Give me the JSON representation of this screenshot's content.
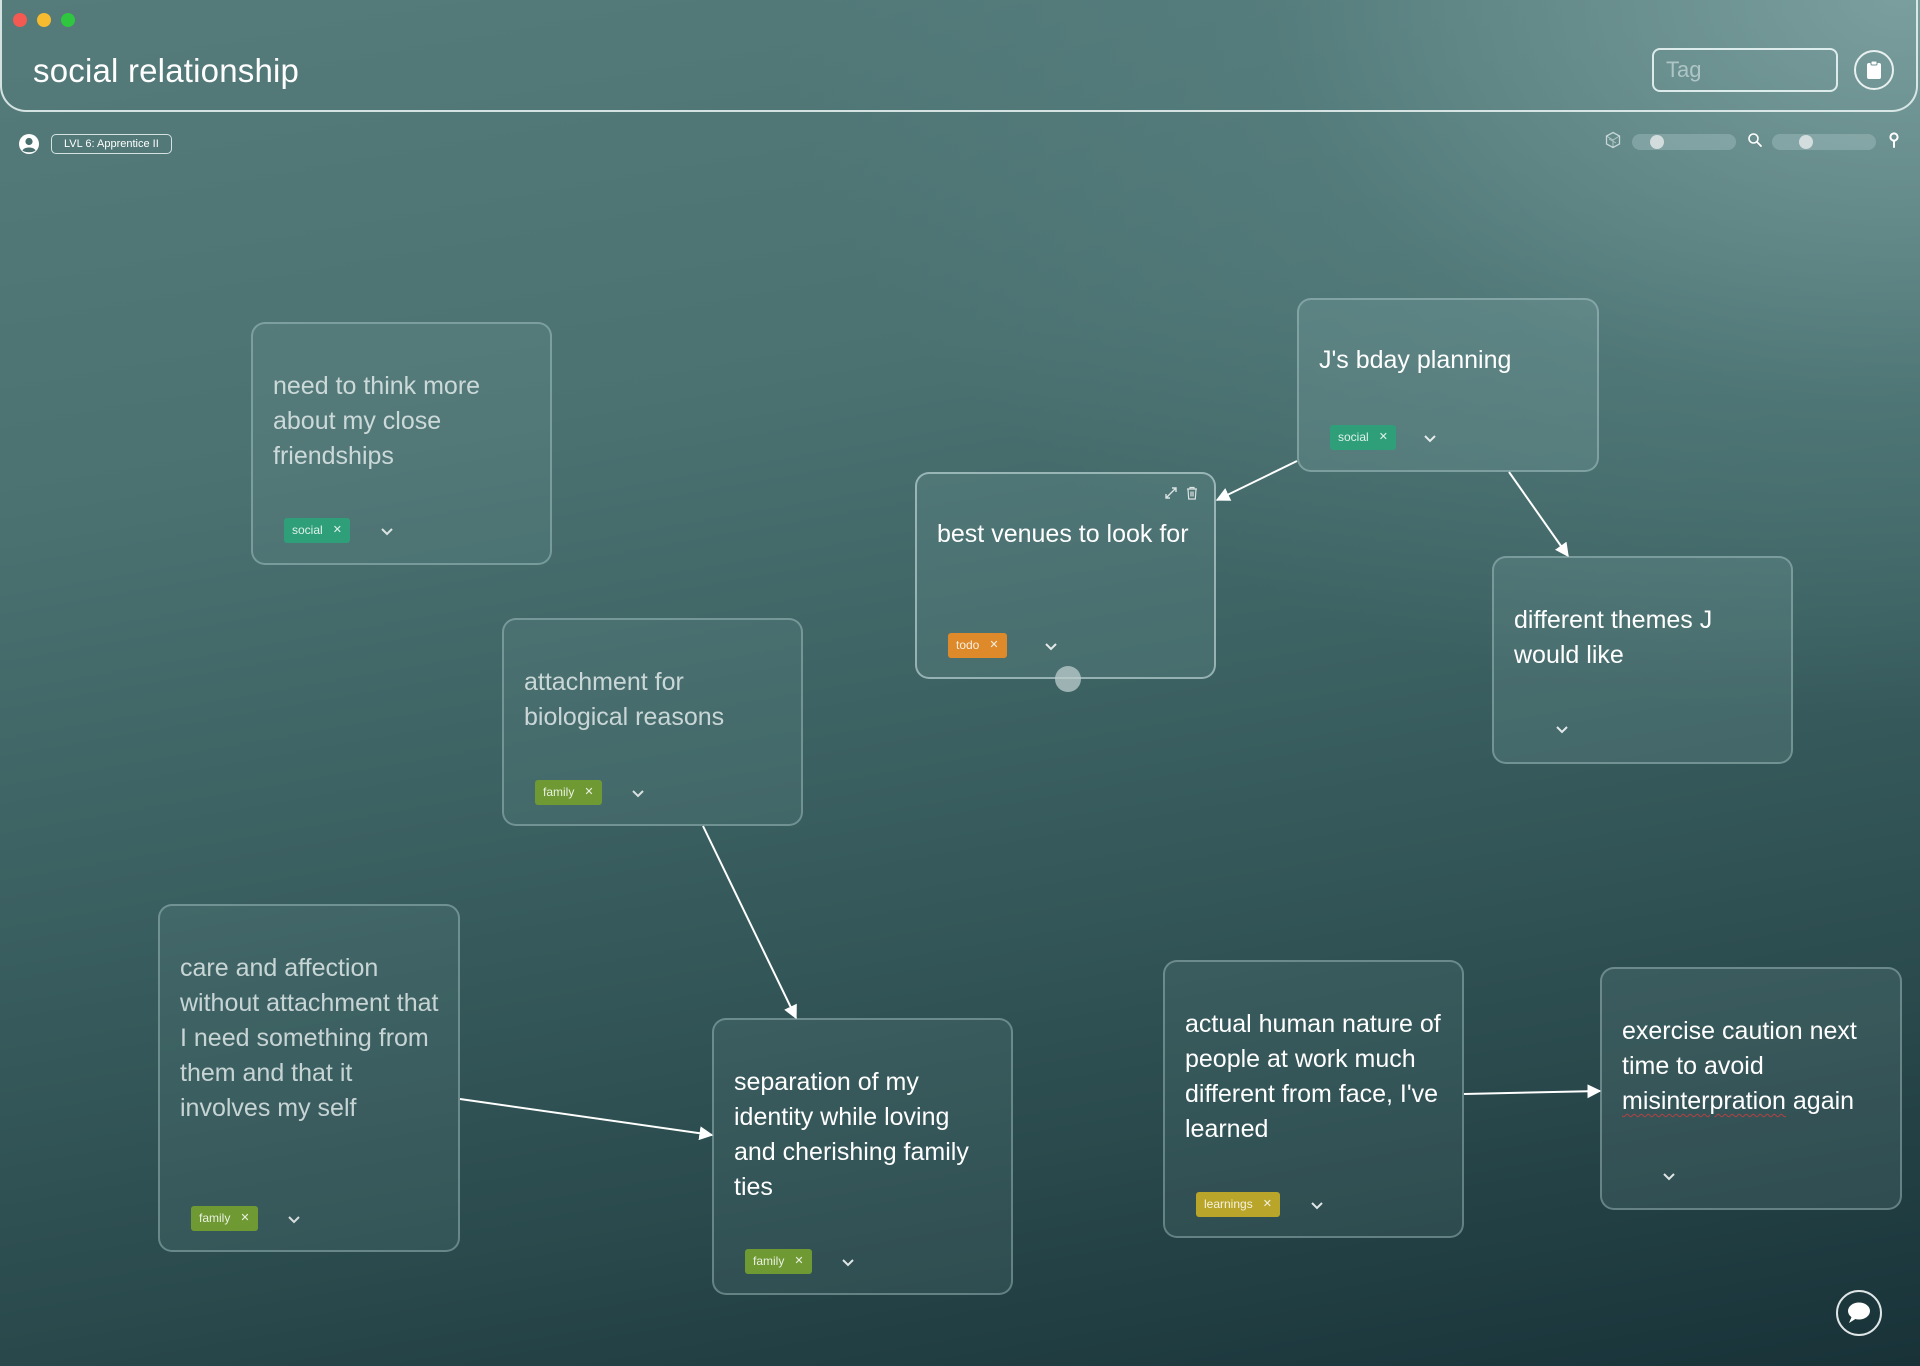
{
  "window": {
    "controls": [
      "close",
      "minimize",
      "maximize"
    ]
  },
  "header": {
    "title": "social relationship",
    "tag_input": {
      "value": "",
      "placeholder": "Tag"
    },
    "clipboard_icon": "clipboard-icon"
  },
  "subbar": {
    "user_icon": "user-circle-icon",
    "level_badge": "LVL 6: Apprentice II",
    "tools": [
      {
        "icon": "network-icon",
        "slider_value": 0.2
      },
      {
        "icon": "search-icon",
        "slider_value": 0.3
      },
      {
        "icon": "pin-icon"
      }
    ]
  },
  "tag_colors": {
    "social": "#2f9f7a",
    "family": "#6f9a33",
    "todo": "#df8a2a",
    "learnings": "#b9a52a"
  },
  "cards": [
    {
      "id": "c1",
      "text": "need to think more about my close friendships",
      "tags": [
        "social"
      ],
      "dim": true
    },
    {
      "id": "c2",
      "text": "J's bday planning",
      "tags": [
        "social"
      ],
      "dim": false
    },
    {
      "id": "c3",
      "text": "best venues to look for",
      "tags": [
        "todo"
      ],
      "dim": false,
      "selected": true,
      "actions": [
        "expand-icon",
        "trash-icon"
      ]
    },
    {
      "id": "c4",
      "text": "different themes J would like",
      "tags": [],
      "dim": false
    },
    {
      "id": "c5",
      "text": "attachment for biological reasons",
      "tags": [
        "family"
      ],
      "dim": true
    },
    {
      "id": "c6",
      "text": "care and affection without attachment that I need something from them and that it involves my self",
      "tags": [
        "family"
      ],
      "dim": true
    },
    {
      "id": "c7",
      "text": "separation of my identity while loving and cherishing family ties",
      "tags": [
        "family"
      ],
      "dim": false
    },
    {
      "id": "c8",
      "text": "actual human nature of people at work much different from face, I've learned",
      "tags": [
        "learnings"
      ],
      "dim": false
    },
    {
      "id": "c9",
      "text_parts": [
        "exercise caution next time to avoid ",
        "misinterpration",
        " again"
      ],
      "tags": [],
      "dim": false
    }
  ],
  "edges": [
    {
      "from": "c2",
      "to": "c3"
    },
    {
      "from": "c2",
      "to": "c4"
    },
    {
      "from": "c5",
      "to": "c7"
    },
    {
      "from": "c6",
      "to": "c7"
    },
    {
      "from": "c8",
      "to": "c9"
    }
  ],
  "chat_button_icon": "chat-bubble-icon"
}
